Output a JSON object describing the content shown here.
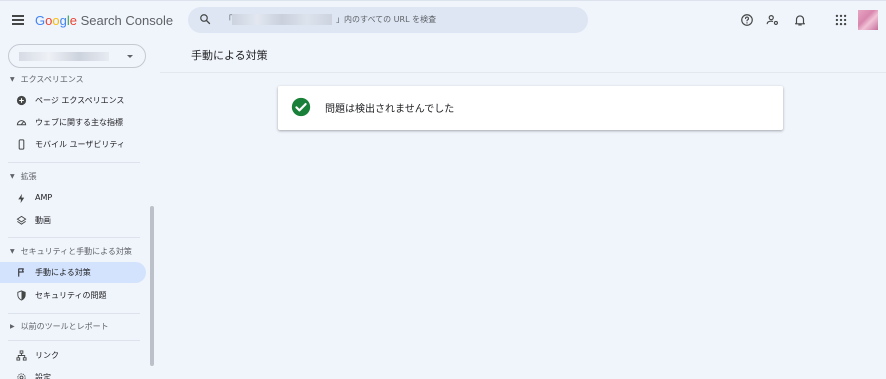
{
  "app": {
    "title_parts": [
      "G",
      "o",
      "o",
      "g",
      "l",
      "e"
    ],
    "title_suffix": "Search Console"
  },
  "search": {
    "prefix": "「",
    "suffix": "」内のすべての URL を検査"
  },
  "header_icons": [
    "help-icon",
    "manage-accounts-icon",
    "notifications-icon",
    "apps-grid-icon",
    "avatar"
  ],
  "sidebar": {
    "sections": [
      {
        "label": "エクスペリエンス",
        "items": [
          {
            "label": "ページ エクスペリエンス",
            "icon": "plus-circle-icon"
          },
          {
            "label": "ウェブに関する主な指標",
            "icon": "gauge-icon"
          },
          {
            "label": "モバイル ユーザビリティ",
            "icon": "smartphone-icon"
          }
        ]
      },
      {
        "label": "拡張",
        "items": [
          {
            "label": "AMP",
            "icon": "bolt-icon"
          },
          {
            "label": "動画",
            "icon": "layers-icon"
          }
        ]
      },
      {
        "label": "セキュリティと手動による対策",
        "items": [
          {
            "label": "手動による対策",
            "icon": "flag-icon",
            "active": true
          },
          {
            "label": "セキュリティの問題",
            "icon": "shield-icon"
          }
        ]
      },
      {
        "label": "以前のツールとレポート",
        "items": []
      }
    ],
    "bottom_items": [
      {
        "label": "リンク",
        "icon": "sitemap-icon"
      },
      {
        "label": "設定",
        "icon": "settings-icon"
      }
    ]
  },
  "main": {
    "page_title": "手動による対策",
    "status_message": "問題は検出されませんでした"
  },
  "colors": {
    "background": "#f0f4fb",
    "active_nav": "#d3e3fd",
    "success_green": "#188038",
    "search_bg": "#dee6f3"
  }
}
